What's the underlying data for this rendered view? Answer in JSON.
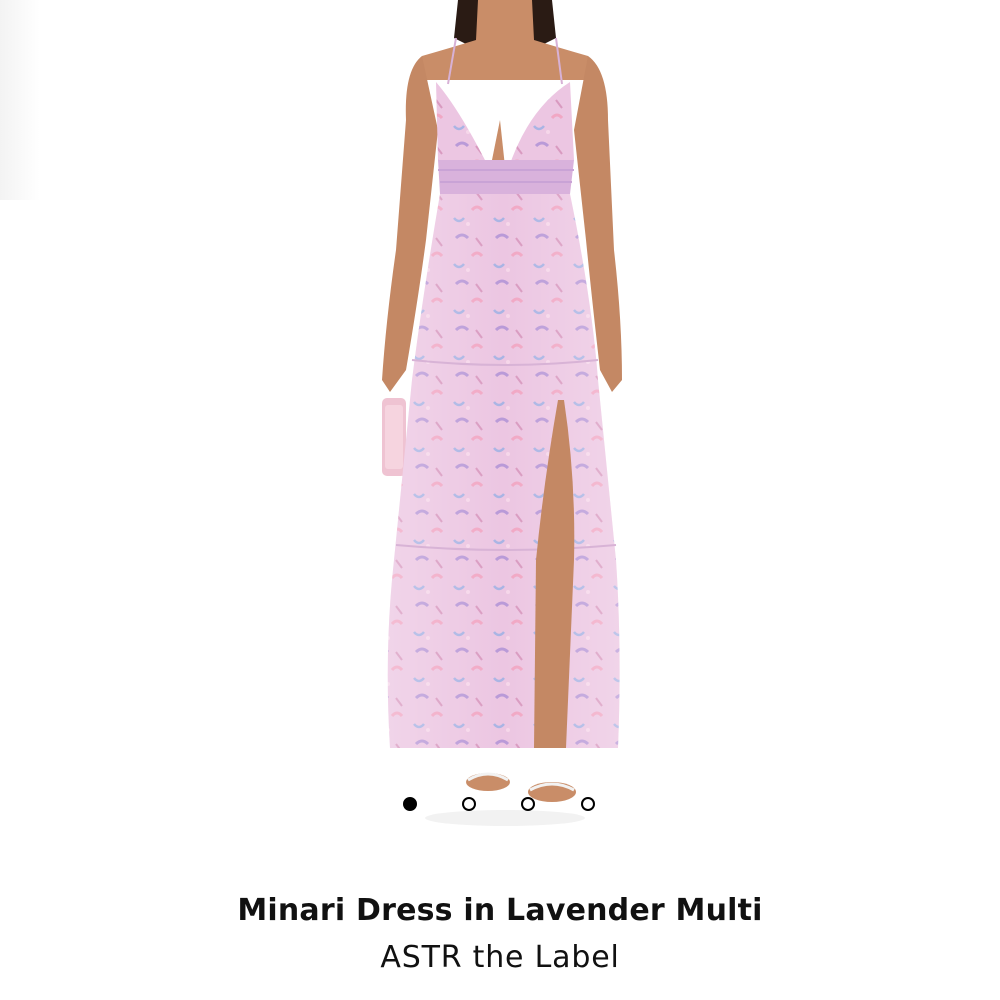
{
  "product": {
    "title": "Minari Dress in Lavender Multi",
    "brand": "ASTR the Label",
    "image": {
      "subject": "dress-photo",
      "dress_color": "#e8c3e0",
      "accent_color": "#c9a3d6",
      "skin_color": "#c98d68"
    }
  },
  "carousel": {
    "total": 4,
    "active_index": 1
  }
}
